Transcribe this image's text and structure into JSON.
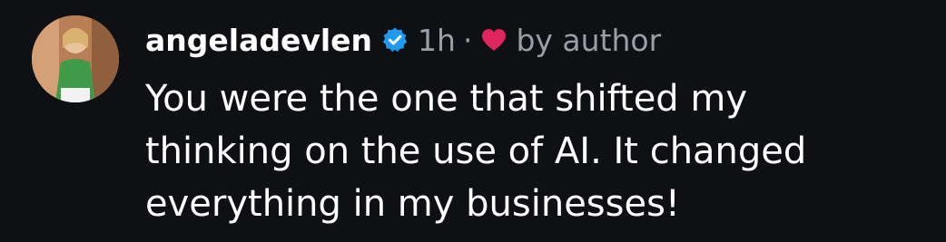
{
  "comment": {
    "username": "angeladevlen",
    "verified_icon": "verified-badge-icon",
    "time": "1h",
    "separator": "·",
    "heart_icon": "heart-icon",
    "liked_by": "by author",
    "text_lines": [
      "You were the one that shifted my",
      "thinking on the use of AI. It changed",
      "everything in my businesses!"
    ]
  },
  "colors": {
    "background": "#0e1013",
    "text": "#ffffff",
    "muted": "#9a9ea5",
    "verified": "#1d9bf0",
    "heart": "#e0245e"
  }
}
